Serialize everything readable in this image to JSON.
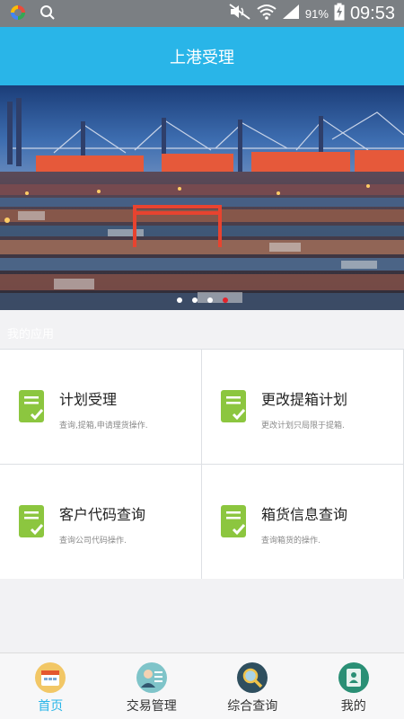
{
  "status_bar": {
    "battery": "91%",
    "time": "09:53",
    "icons": [
      "app-logo-icon",
      "search-icon",
      "mute-icon",
      "wifi-icon",
      "signal-icon",
      "battery-charging-icon"
    ]
  },
  "header": {
    "title": "上港受理"
  },
  "banner": {
    "image": "container-port-night-photo",
    "dot_count": 4,
    "active_dot": 4
  },
  "section": {
    "label": "我的应用"
  },
  "apps": [
    {
      "title": "计划受理",
      "desc": "查询,提箱,申请理货操作.",
      "icon": "document-check-icon"
    },
    {
      "title": "更改提箱计划",
      "desc": "更改计划只局限于提箱.",
      "icon": "document-check-icon"
    },
    {
      "title": "客户代码查询",
      "desc": "查询公司代码操作.",
      "icon": "document-check-icon"
    },
    {
      "title": "箱货信息查询",
      "desc": "查询箱货的操作.",
      "icon": "document-check-icon"
    }
  ],
  "bottom_nav": [
    {
      "label": "首页",
      "icon": "home-calendar-icon",
      "active": true
    },
    {
      "label": "交易管理",
      "icon": "transaction-icon",
      "active": false
    },
    {
      "label": "综合查询",
      "icon": "magnifier-icon",
      "active": false
    },
    {
      "label": "我的",
      "icon": "profile-icon",
      "active": false
    }
  ],
  "colors": {
    "accent": "#29b5e8",
    "status_bar": "#7b7f83",
    "icon_green": "#8cc63f",
    "active_dot": "#e4232b"
  }
}
